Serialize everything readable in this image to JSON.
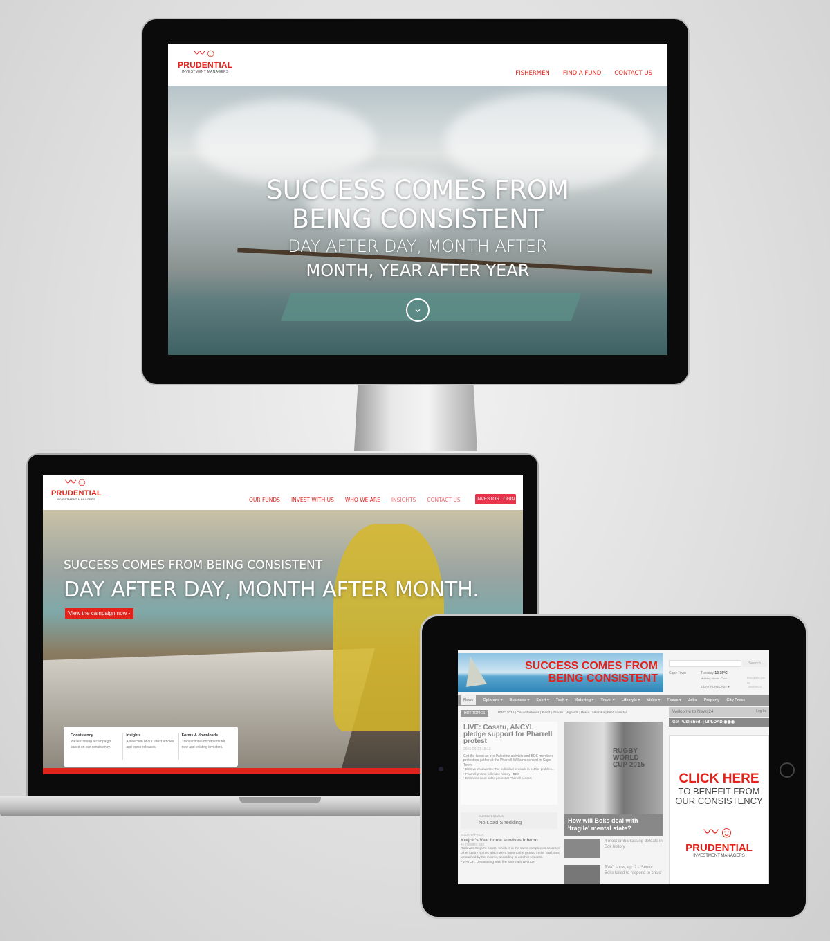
{
  "monitor": {
    "logo": {
      "name": "PRUDENTIAL",
      "sub": "INVESTMENT MANAGERS"
    },
    "nav": [
      "FISHERMEN",
      "FIND A FUND",
      "CONTACT US"
    ],
    "hero": {
      "line1": "SUCCESS COMES FROM",
      "line2": "BEING CONSISTENT",
      "line3": "DAY AFTER DAY, MONTH AFTER",
      "line4": "MONTH, YEAR AFTER YEAR"
    }
  },
  "laptop": {
    "logo": {
      "name": "PRUDENTIAL",
      "sub": "INVESTMENT MANAGERS"
    },
    "nav": [
      "OUR FUNDS",
      "INVEST WITH US",
      "WHO WE ARE",
      "INSIGHTS",
      "CONTACT US"
    ],
    "login": "INVESTOR LOGIN",
    "hero": {
      "line1": "SUCCESS COMES FROM BEING CONSISTENT",
      "line2": "DAY AFTER DAY, MONTH AFTER MONTH.",
      "cta": "View the campaign now ›"
    },
    "cards": [
      {
        "title": "Consistency",
        "text": "We're running a campaign based on our consistency."
      },
      {
        "title": "Insights",
        "text": "A selection of our latest articles and press releases."
      },
      {
        "title": "Forms & downloads",
        "text": "Transactional documents for new and existing investors."
      }
    ]
  },
  "tablet": {
    "banner": {
      "line1": "SUCCESS COMES FROM",
      "line2": "BEING CONSISTENT"
    },
    "search_button": "Search",
    "weather": {
      "city": "Cape Town",
      "day": "Tuesday",
      "temp": "12-16°C",
      "desc": "Morning clouds. Cool.",
      "forecast": "3 DAY FORECAST ▾",
      "brought": "Brought to you by:",
      "sponsor": "weather24"
    },
    "nav": [
      "News",
      "Opinions ▾",
      "Business ▾",
      "Sport ▾",
      "Tech ▾",
      "Motoring ▾",
      "Travel ▾",
      "Lifestyle ▾",
      "Video ▾",
      "Focus ▾",
      "Jobs",
      "Property",
      "City Press"
    ],
    "hot_topics_label": "HOT TOPICS",
    "hot_topics": "RWC 2015 | Oscar Pistorius | Rand | Eskom | Migrants | Prasa | Nkandla | FIFA scandal",
    "welcome": "Welcome to News24",
    "login": "Log In",
    "get_published": "Get Published!",
    "upload": "UPLOAD",
    "lead": {
      "title": "LIVE: Cosatu, ANCYL pledge support for Pharrell protest",
      "time": "2015-09-21 15:12",
      "summary": "Get the latest as pro-Palestine activists and BDS members protestors gather at the Pharrell Williams concert in Cape Town.",
      "bullets": [
        "BDS vs Woolworths: The individual avocado is not the problem...",
        "Pharrell protest will make history - BDS",
        "BDS wins court bid to protest at Pharrell concert"
      ]
    },
    "status": {
      "label": "CURRENT STATUS",
      "value": "No Load Shedding"
    },
    "story": {
      "section": "SOUTH AFRICA",
      "title": "Krejcir's Vaal home survives inferno",
      "time": "47 minutes ago",
      "text": "Radovan Krejcir's house, which is in the same complex as scores of other luxury homes which were burnt to the ground in the Vaal, was untouched by the inferno, according to another resident.",
      "bullet": "• WATCH: Devastating Vaal fire aftermath  WATCH"
    },
    "feature": {
      "poster": "RUGBY WORLD CUP 2015",
      "caption": "How will Boks deal with 'fragile' mental state?"
    },
    "side_stories": [
      "4 most embarrassing defeats in Bok history",
      "RWC show, ep. 2 - 'Senior Boks failed to respond to crisis'"
    ],
    "ad": {
      "line1": "CLICK HERE",
      "line2": "TO BENEFIT FROM",
      "line3": "OUR CONSISTENCY",
      "logo": "PRUDENTIAL",
      "sub": "INVESTMENT MANAGERS"
    }
  },
  "colors": {
    "brand_red": "#e3231b"
  }
}
